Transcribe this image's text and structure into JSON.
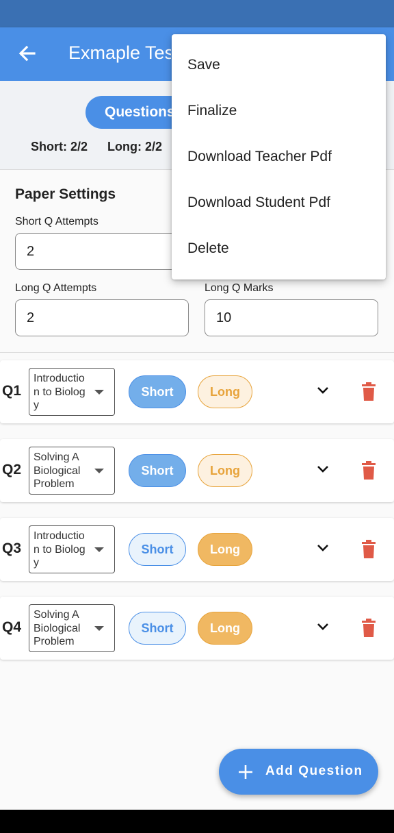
{
  "app_title": "Exmaple Test",
  "tabs": {
    "active": "Questions"
  },
  "counts": {
    "short": "Short: 2/2",
    "long": "Long: 2/2"
  },
  "settings": {
    "title": "Paper Settings",
    "short_attempts_label": "Short Q Attempts",
    "short_attempts_value": "2",
    "long_attempts_label": "Long Q Attempts",
    "long_attempts_value": "2",
    "long_marks_label": "Long Q Marks",
    "long_marks_value": "10"
  },
  "questions": [
    {
      "num": "Q1",
      "topic": "Introduction to Biology",
      "type": "short",
      "short_label": "Short",
      "long_label": "Long"
    },
    {
      "num": "Q2",
      "topic": "Solving A Biological Problem",
      "type": "short",
      "short_label": "Short",
      "long_label": "Long"
    },
    {
      "num": "Q3",
      "topic": "Introduction to Biology",
      "type": "long",
      "short_label": "Short",
      "long_label": "Long"
    },
    {
      "num": "Q4",
      "topic": "Solving A Biological Problem",
      "type": "long",
      "short_label": "Short",
      "long_label": "Long"
    }
  ],
  "menu": {
    "items": [
      "Save",
      "Finalize",
      "Download Teacher Pdf",
      "Download Student Pdf",
      "Delete"
    ]
  },
  "fab": {
    "label": "Add Question"
  },
  "colors": {
    "primary": "#4a8fe6",
    "status_bar": "#3a70b3",
    "accent_long": "#e7a33a",
    "delete": "#e05a47"
  }
}
